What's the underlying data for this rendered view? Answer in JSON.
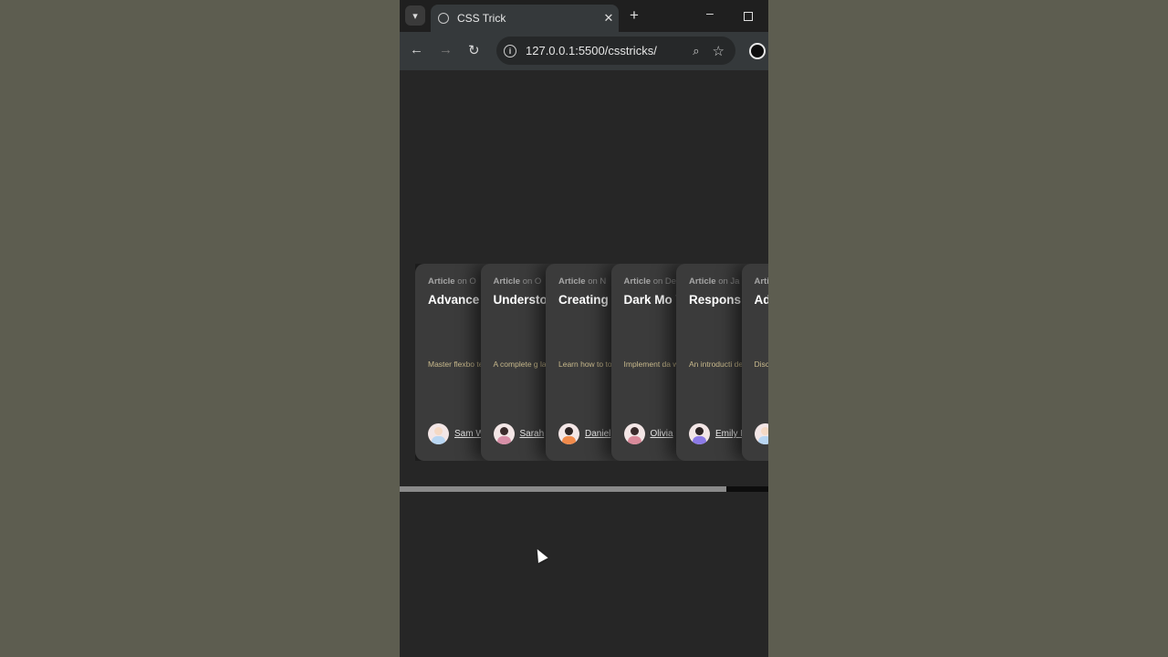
{
  "tab": {
    "title": "CSS Trick",
    "close": "✕",
    "new_tab": "+"
  },
  "window": {
    "minimize": "–"
  },
  "toolbar": {
    "back": "←",
    "forward": "→",
    "reload": "↻",
    "url": "127.0.0.1:5500/csstricks/",
    "info": "i",
    "zoom": "🔍",
    "star": "☆"
  },
  "cards": [
    {
      "meta_type": "Article",
      "meta_rest": " on O",
      "title": "Advance Flexbox",
      "desc": "Master flexbo techniques ar responsive we",
      "author": "Sam W",
      "avatar_head": "#f5d9c4",
      "avatar_body": "#b9d6f2"
    },
    {
      "meta_type": "Article",
      "meta_rest": " on O",
      "title": "Understo Grid",
      "desc": "A complete g layout, with p grid-based d",
      "author": "Sarah",
      "avatar_head": "#3a2b2b",
      "avatar_body": "#d78fa7"
    },
    {
      "meta_type": "Article",
      "meta_rest": " on N",
      "title": "Creating with CSS",
      "desc": "Learn how to to life with ke CSS.",
      "author": "Daniel",
      "avatar_head": "#2e2424",
      "avatar_body": "#f08a4b"
    },
    {
      "meta_type": "Article",
      "meta_rest": " on De",
      "title": "Dark Mo Variable",
      "desc": "Implement da website using properties an",
      "author": "Olivia",
      "avatar_head": "#3a2b2b",
      "avatar_body": "#d98a9a"
    },
    {
      "meta_type": "Article",
      "meta_rest": " on Ja",
      "title": "Respons Design B",
      "desc": "An introducti design, with m fluid layouts.",
      "author": "Emily I",
      "avatar_head": "#2e2424",
      "avatar_body": "#8c7ae6"
    },
    {
      "meta_type": "Arti",
      "meta_rest": "",
      "title": "Ad CS",
      "desc": "Disc and style",
      "author": "",
      "avatar_head": "#f5d9c4",
      "avatar_body": "#b9d6f2"
    }
  ],
  "scroll": {
    "progress": 0.885
  }
}
